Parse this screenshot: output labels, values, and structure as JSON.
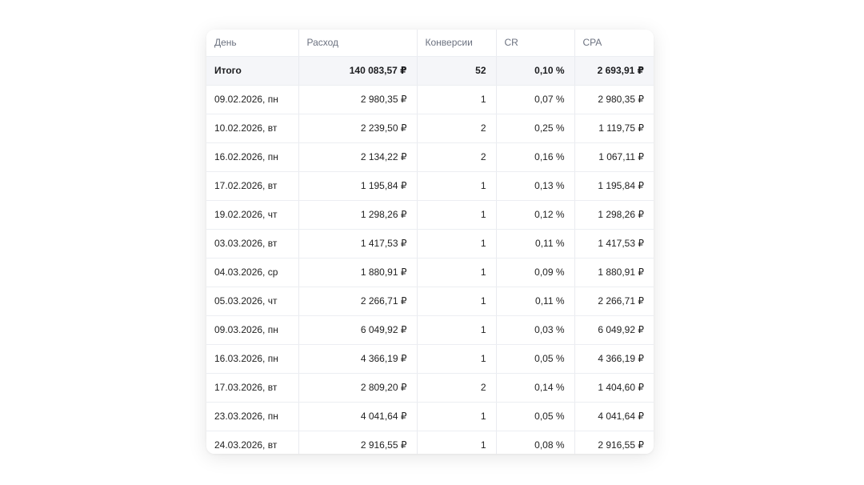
{
  "table": {
    "headers": {
      "day": "День",
      "spend": "Расход",
      "conversions": "Конверсии",
      "cr": "CR",
      "cpa": "CPA"
    },
    "total": {
      "day": "Итого",
      "spend": "140 083,57 ₽",
      "conversions": "52",
      "cr": "0,10 %",
      "cpa": "2 693,91 ₽"
    },
    "rows": [
      {
        "day": "09.02.2026, пн",
        "spend": "2 980,35 ₽",
        "conversions": "1",
        "cr": "0,07 %",
        "cpa": "2 980,35 ₽"
      },
      {
        "day": "10.02.2026, вт",
        "spend": "2 239,50 ₽",
        "conversions": "2",
        "cr": "0,25 %",
        "cpa": "1 119,75 ₽"
      },
      {
        "day": "16.02.2026, пн",
        "spend": "2 134,22 ₽",
        "conversions": "2",
        "cr": "0,16 %",
        "cpa": "1 067,11 ₽"
      },
      {
        "day": "17.02.2026, вт",
        "spend": "1 195,84 ₽",
        "conversions": "1",
        "cr": "0,13 %",
        "cpa": "1 195,84 ₽"
      },
      {
        "day": "19.02.2026, чт",
        "spend": "1 298,26 ₽",
        "conversions": "1",
        "cr": "0,12 %",
        "cpa": "1 298,26 ₽"
      },
      {
        "day": "03.03.2026, вт",
        "spend": "1 417,53 ₽",
        "conversions": "1",
        "cr": "0,11 %",
        "cpa": "1 417,53 ₽"
      },
      {
        "day": "04.03.2026, ср",
        "spend": "1 880,91 ₽",
        "conversions": "1",
        "cr": "0,09 %",
        "cpa": "1 880,91 ₽"
      },
      {
        "day": "05.03.2026, чт",
        "spend": "2 266,71 ₽",
        "conversions": "1",
        "cr": "0,11 %",
        "cpa": "2 266,71 ₽"
      },
      {
        "day": "09.03.2026, пн",
        "spend": "6 049,92 ₽",
        "conversions": "1",
        "cr": "0,03 %",
        "cpa": "6 049,92 ₽"
      },
      {
        "day": "16.03.2026, пн",
        "spend": "4 366,19 ₽",
        "conversions": "1",
        "cr": "0,05 %",
        "cpa": "4 366,19 ₽"
      },
      {
        "day": "17.03.2026, вт",
        "spend": "2 809,20 ₽",
        "conversions": "2",
        "cr": "0,14 %",
        "cpa": "1 404,60 ₽"
      },
      {
        "day": "23.03.2026, пн",
        "spend": "4 041,64 ₽",
        "conversions": "1",
        "cr": "0,05 %",
        "cpa": "4 041,64 ₽"
      },
      {
        "day": "24.03.2026, вт",
        "spend": "2 916,55 ₽",
        "conversions": "1",
        "cr": "0,08 %",
        "cpa": "2 916,55 ₽"
      }
    ]
  }
}
